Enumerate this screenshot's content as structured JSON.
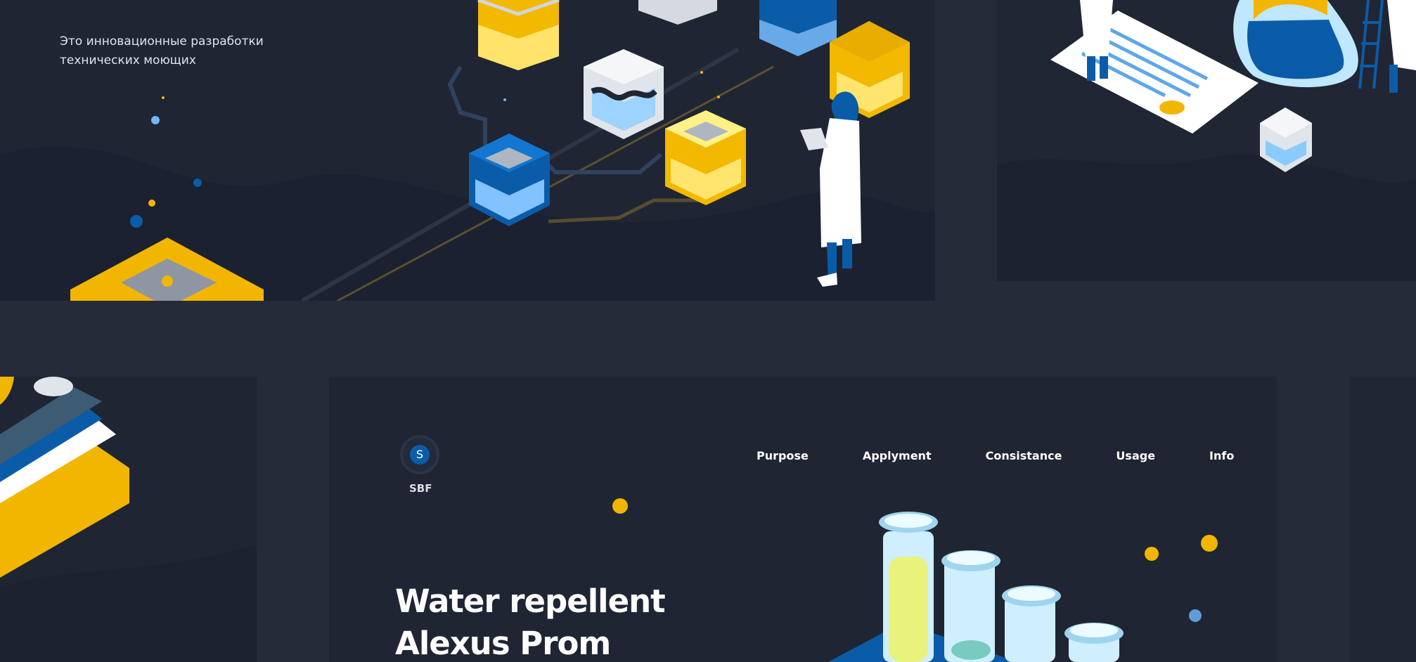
{
  "hero": {
    "description": "Это инновационные разработки технических моющих"
  },
  "brand": {
    "mark": "S",
    "name": "SBF"
  },
  "navigation": {
    "items": [
      "Purpose",
      "Applyment",
      "Consistance",
      "Usage",
      "Info"
    ]
  },
  "product": {
    "title_line_1": "Water repellent",
    "title_line_2": "Alexus Prom"
  },
  "colors": {
    "background": "#252b38",
    "panel": "#1f2533",
    "accent_yellow": "#f2b600",
    "accent_blue": "#0b5ca8",
    "light_blue": "#cfefff"
  }
}
